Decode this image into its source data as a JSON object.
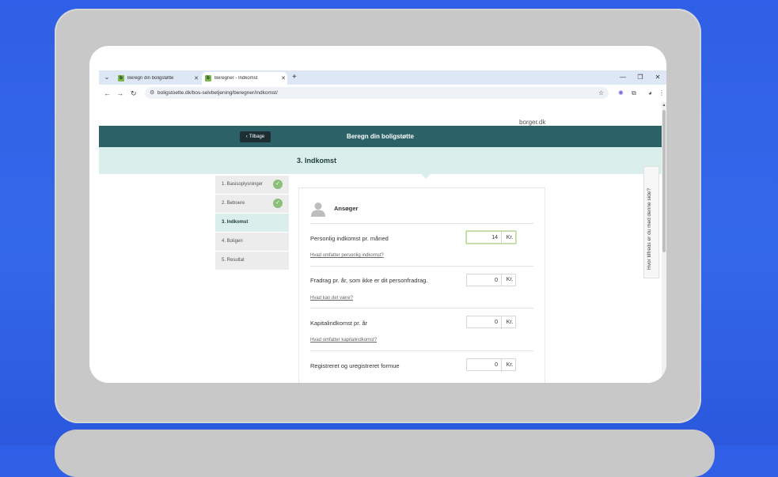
{
  "browser": {
    "tabs": [
      {
        "title": "Beregn din boligstøtte",
        "active": false
      },
      {
        "title": "Beregner - Indkomst",
        "active": true
      }
    ],
    "new_tab": "+",
    "window_controls": {
      "minimize": "—",
      "restore": "❐",
      "close": "✕"
    },
    "url": "boligstoette.dk/bos-selvbetjening/beregner/indkomst/"
  },
  "site": {
    "brand": "borger.dk",
    "back_label": "Tilbage",
    "header_title": "Beregn din boligstøtte",
    "current_step_title": "3. Indkomst"
  },
  "steps": [
    {
      "label": "1. Basisoplysninger",
      "done": true
    },
    {
      "label": "2. Beboere",
      "done": true
    },
    {
      "label": "3. Indkomst",
      "active": true
    },
    {
      "label": "4. Boligen"
    },
    {
      "label": "5. Resultat"
    }
  ],
  "form": {
    "applicant_label": "Ansøger",
    "rows": [
      {
        "label": "Personlig indkomst pr. måned",
        "value": "14",
        "unit": "Kr.",
        "link": "Hvad omfatter personlig indkomst?"
      },
      {
        "label": "Fradrag pr. år, som ikke er dit personfradrag.",
        "value": "0",
        "unit": "Kr.",
        "link": "Hvad kan det være?"
      },
      {
        "label": "Kapitalindkomst pr. år",
        "value": "0",
        "unit": "Kr.",
        "link": "Hvad omfatter kapitalindkomst?"
      },
      {
        "label": "Registreret og uregistreret formue",
        "value": "0",
        "unit": "Kr.",
        "link": ""
      }
    ]
  },
  "feedback": {
    "label": "Hvor tilfreds er du med denne side?"
  },
  "colors": {
    "header": "#2d6168",
    "stepbar": "#daefec",
    "check": "#8bc07a"
  }
}
